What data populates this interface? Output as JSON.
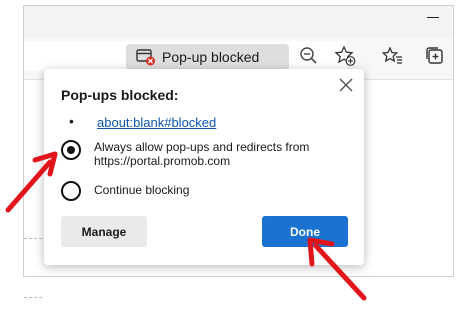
{
  "toolbar": {
    "popup_indicator_label": "Pop-up blocked"
  },
  "dialog": {
    "title": "Pop-ups blocked:",
    "bullet": "•",
    "blocked_link": "about:blank#blocked",
    "option_allow_line1": "Always allow pop-ups and redirects from",
    "option_allow_line2": "https://portal.promob.com",
    "option_block": "Continue blocking",
    "selected_option": "allow",
    "manage_button": "Manage",
    "done_button": "Done"
  },
  "colors": {
    "accent": "#1a73d0",
    "annotation_arrow": "#e1141c",
    "link": "#0b57b0"
  }
}
